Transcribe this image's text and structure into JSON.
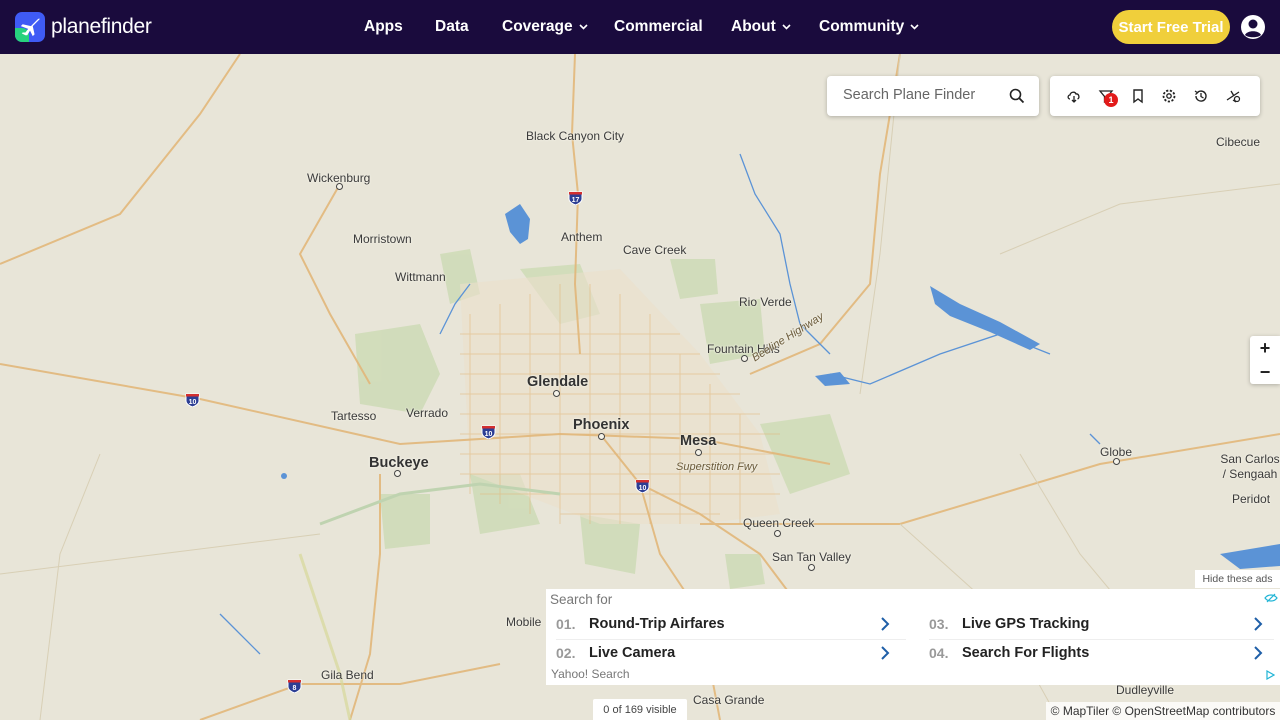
{
  "header": {
    "brand": "planefinder",
    "nav": [
      {
        "label": "Apps",
        "dropdown": false
      },
      {
        "label": "Data",
        "dropdown": false
      },
      {
        "label": "Coverage",
        "dropdown": true
      },
      {
        "label": "Commercial",
        "dropdown": false
      },
      {
        "label": "About",
        "dropdown": true
      },
      {
        "label": "Community",
        "dropdown": true
      }
    ],
    "trial_button": "Start Free Trial"
  },
  "search": {
    "placeholder": "Search Plane Finder"
  },
  "toolbar": {
    "icons": [
      "weather-icon",
      "filter-icon",
      "bookmark-icon",
      "settings-icon",
      "history-icon",
      "playback-icon"
    ],
    "filter_badge": "1"
  },
  "zoom": {
    "in": "+",
    "out": "−"
  },
  "map": {
    "places": [
      {
        "name": "Black Canyon City",
        "kind": "town"
      },
      {
        "name": "Cibecue",
        "kind": "town"
      },
      {
        "name": "Wickenburg",
        "kind": "town"
      },
      {
        "name": "Anthem",
        "kind": "town"
      },
      {
        "name": "Morristown",
        "kind": "town"
      },
      {
        "name": "Cave Creek",
        "kind": "town"
      },
      {
        "name": "Wittmann",
        "kind": "town"
      },
      {
        "name": "Rio Verde",
        "kind": "town"
      },
      {
        "name": "Fountain Hills",
        "kind": "town"
      },
      {
        "name": "Glendale",
        "kind": "city"
      },
      {
        "name": "Tartesso",
        "kind": "town"
      },
      {
        "name": "Verrado",
        "kind": "town"
      },
      {
        "name": "Phoenix",
        "kind": "city"
      },
      {
        "name": "Mesa",
        "kind": "city"
      },
      {
        "name": "Buckeye",
        "kind": "city"
      },
      {
        "name": "Globe",
        "kind": "town"
      },
      {
        "name": "San Carlos / Sengaah",
        "kind": "town"
      },
      {
        "name": "Peridot",
        "kind": "town"
      },
      {
        "name": "Queen Creek",
        "kind": "town"
      },
      {
        "name": "San Tan Valley",
        "kind": "town"
      },
      {
        "name": "Mobile",
        "kind": "town"
      },
      {
        "name": "Gila Bend",
        "kind": "town"
      },
      {
        "name": "Casa Grande",
        "kind": "town"
      },
      {
        "name": "Dudleyville",
        "kind": "town"
      }
    ],
    "roads": [
      "Beeline Highway",
      "Superstition Fwy"
    ],
    "shields": [
      "17",
      "10",
      "10",
      "10",
      "8"
    ]
  },
  "ads": {
    "hide_label": "Hide these ads",
    "header": "Search for",
    "items": [
      {
        "num": "01.",
        "text": "Round-Trip Airfares"
      },
      {
        "num": "02.",
        "text": "Live Camera"
      },
      {
        "num": "03.",
        "text": "Live GPS Tracking"
      },
      {
        "num": "04.",
        "text": "Search For Flights"
      }
    ],
    "footer": "Yahoo! Search"
  },
  "status": {
    "visible_count": "0 of 169 visible"
  },
  "attribution": "© MapTiler © OpenStreetMap contributors",
  "colors": {
    "nav_bg": "#1a0b3d",
    "trial_bg": "#f0cf3b",
    "badge": "#e21b1b",
    "water": "#5b93d6",
    "road": "#e2b77a"
  }
}
